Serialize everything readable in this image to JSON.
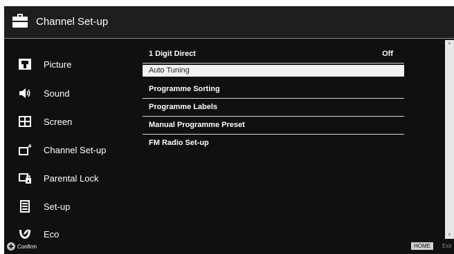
{
  "header": {
    "title": "Channel Set-up",
    "icon": "toolbox-icon"
  },
  "sidebar": {
    "items": [
      {
        "label": "Picture",
        "icon": "picture-icon"
      },
      {
        "label": "Sound",
        "icon": "speaker-icon"
      },
      {
        "label": "Screen",
        "icon": "screen-icon"
      },
      {
        "label": "Channel Set-up",
        "icon": "channel-setup-icon"
      },
      {
        "label": "Parental Lock",
        "icon": "parental-lock-icon"
      },
      {
        "label": "Set-up",
        "icon": "setup-icon"
      },
      {
        "label": "Eco",
        "icon": "eco-icon"
      }
    ]
  },
  "menu": {
    "items": [
      {
        "label": "1 Digit Direct",
        "value": "Off"
      },
      {
        "label": "Auto Tuning",
        "value": "",
        "selected": true
      },
      {
        "label": "Programme Sorting",
        "value": ""
      },
      {
        "label": "Programme Labels",
        "value": ""
      },
      {
        "label": "Manual Programme Preset",
        "value": ""
      },
      {
        "label": "FM Radio Set-up",
        "value": ""
      }
    ]
  },
  "footer": {
    "confirm_label": "Confirm",
    "home_key": "HOME",
    "exit_label": "Exit"
  },
  "colors": {
    "background": "#101010",
    "header": "#1e1e1e",
    "selected_row": "#f2f2f2",
    "text": "#ffffff"
  }
}
